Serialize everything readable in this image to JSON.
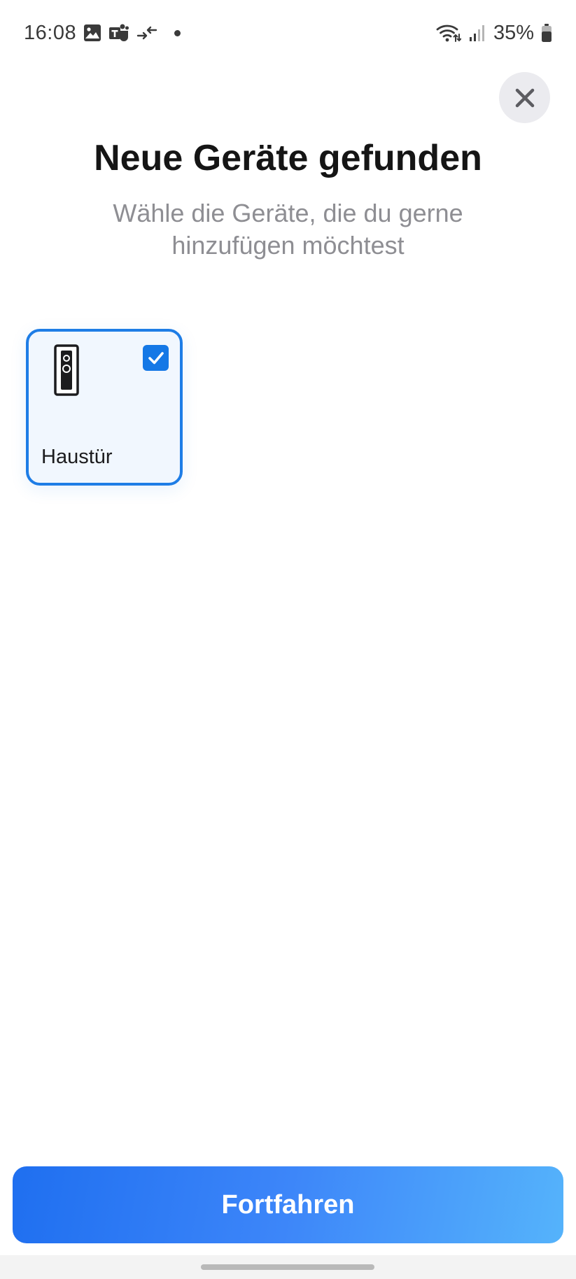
{
  "status_bar": {
    "time": "16:08",
    "battery_text": "35%",
    "icons": [
      "gallery-icon",
      "teams-icon",
      "data-transfer-icon",
      "notification-dot-icon",
      "wifi-icon",
      "signal-icon",
      "battery-icon"
    ]
  },
  "header": {
    "title": "Neue Geräte gefunden",
    "subtitle": "Wähle die Geräte, die du gerne hinzufügen möchtest"
  },
  "devices": [
    {
      "label": "Haustür",
      "icon": "doorbell-icon",
      "selected": true
    }
  ],
  "footer": {
    "continue_label": "Fortfahren"
  },
  "colors": {
    "accent": "#1e7de6",
    "card_background": "#f1f7fe",
    "button_gradient_start": "#1f6ff0",
    "button_gradient_end": "#55b3fb",
    "title": "#151515",
    "subtitle": "#8e8e93"
  }
}
